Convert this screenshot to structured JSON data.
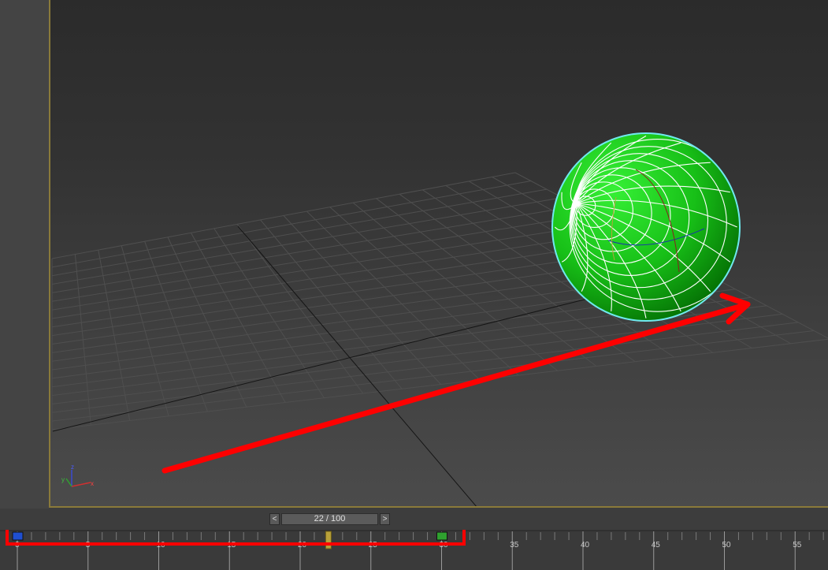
{
  "viewport": {
    "axis_labels": {
      "x": "x",
      "y": "y",
      "z": "z"
    }
  },
  "time_slider": {
    "prev_label": "<",
    "next_label": ">",
    "frame_display": "22 / 100",
    "current_frame": 22,
    "total_frames": 100
  },
  "timeline": {
    "tick_labels": [
      "0",
      "5",
      "10",
      "15",
      "20",
      "25",
      "30",
      "35",
      "40",
      "45",
      "50",
      "55"
    ],
    "keyframes": [
      0,
      30
    ],
    "colors": {
      "keyframe_a": "#1f4fd0",
      "keyframe_b": "#2fa12f",
      "playhead": "#b8a13a"
    }
  },
  "annotations": {
    "arrow_color": "#ff0000",
    "highlight_color": "#ff0000"
  },
  "object": {
    "color": "#1ec81e",
    "selection_outline": "#6fe9ef"
  }
}
